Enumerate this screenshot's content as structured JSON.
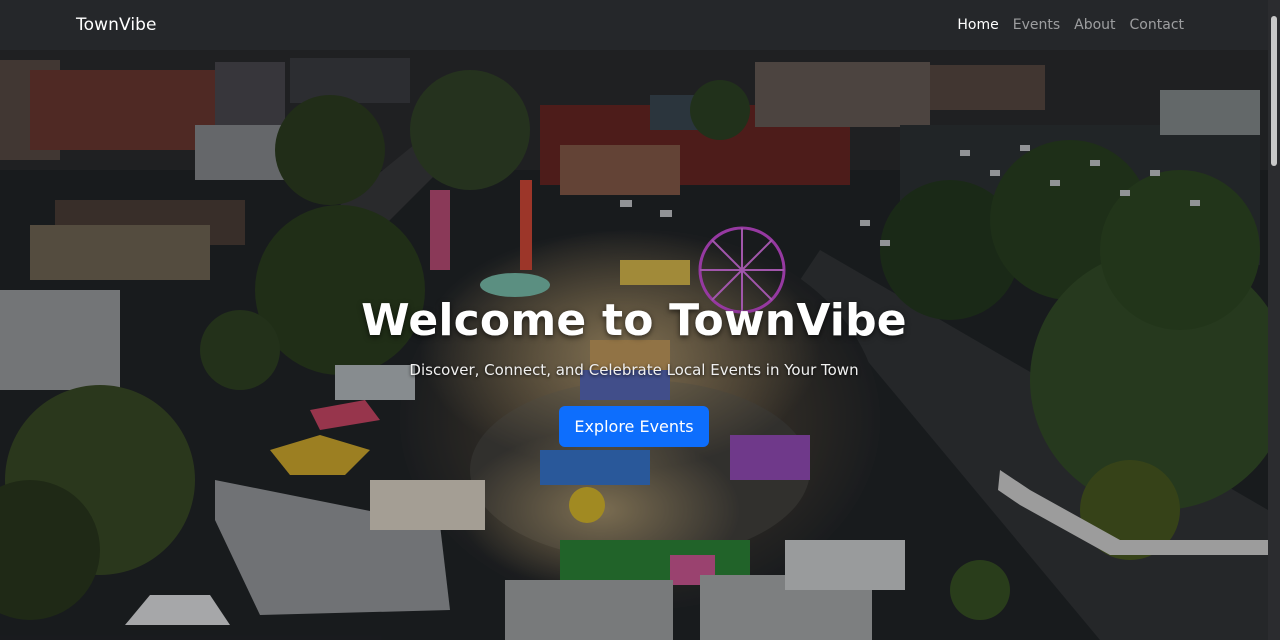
{
  "navbar": {
    "brand": "TownVibe",
    "links": [
      {
        "label": "Home",
        "active": true
      },
      {
        "label": "Events",
        "active": false
      },
      {
        "label": "About",
        "active": false
      },
      {
        "label": "Contact",
        "active": false
      }
    ]
  },
  "hero": {
    "title": "Welcome to TownVibe",
    "subtitle": "Discover, Connect, and Celebrate Local Events in Your Town",
    "cta_label": "Explore Events",
    "background": "aerial-night-town-carnival-photo"
  },
  "colors": {
    "navbar_bg": "#25272a",
    "accent": "#0d6efd",
    "nav_inactive": "rgba(255,255,255,0.55)"
  }
}
